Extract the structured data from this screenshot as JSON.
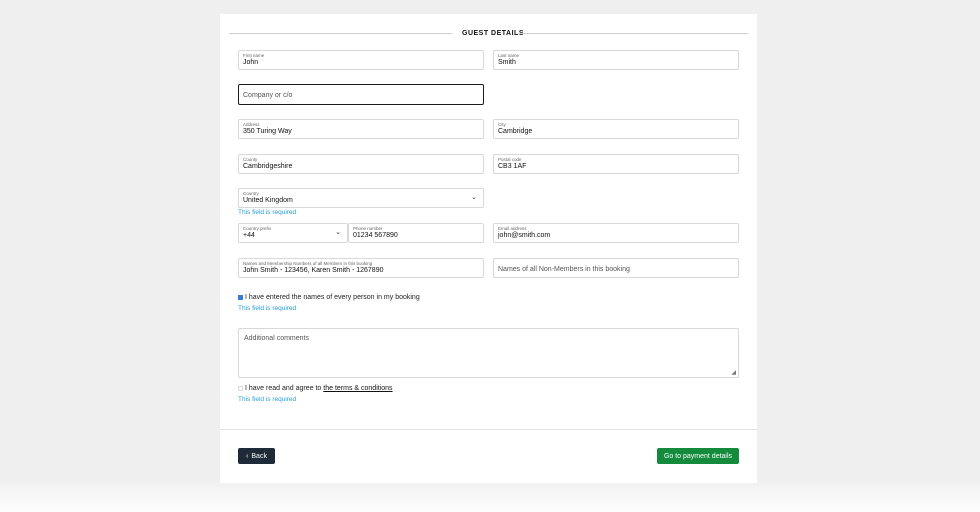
{
  "section": {
    "title": "GUEST DETAILS"
  },
  "fields": {
    "first_name": {
      "label": "First name",
      "value": "John"
    },
    "last_name": {
      "label": "Last name",
      "value": "Smith"
    },
    "company": {
      "placeholder": "Company or c/o"
    },
    "address": {
      "label": "Address",
      "value": "350 Turing Way"
    },
    "city": {
      "label": "City",
      "value": "Cambridge"
    },
    "county": {
      "label": "County",
      "value": "Cambridgeshire"
    },
    "postal_code": {
      "label": "Postal code",
      "value": "CB3 1AF"
    },
    "country": {
      "label": "Country",
      "value": "United Kingdom",
      "error": "This field is required"
    },
    "country_prefix": {
      "label": "Country prefix",
      "value": "+44"
    },
    "phone": {
      "label": "Phone number",
      "value": "01234 567890"
    },
    "email": {
      "label": "Email address",
      "value": "john@smith.com"
    },
    "members": {
      "label": "Names and Membership Numbers of all Members in this booking",
      "value": "John Smith - 123456, Karen Smith - 1267890"
    },
    "non_members": {
      "placeholder": "Names of all Non-Members in this booking"
    },
    "comments": {
      "placeholder": "Additional comments"
    }
  },
  "checks": {
    "names_entered": {
      "label": "I have entered the names of every person in my booking",
      "checked": true,
      "error": "This field is required"
    },
    "terms": {
      "label": "I have read and agree to",
      "link": "the terms & conditions",
      "checked": false,
      "error": "This field is required"
    }
  },
  "buttons": {
    "back": "Back",
    "pay": "Go to payment details"
  },
  "colors": {
    "back_button": "#1e2a38",
    "pay_button": "#138a3c",
    "error_text": "#2a9dd6"
  }
}
